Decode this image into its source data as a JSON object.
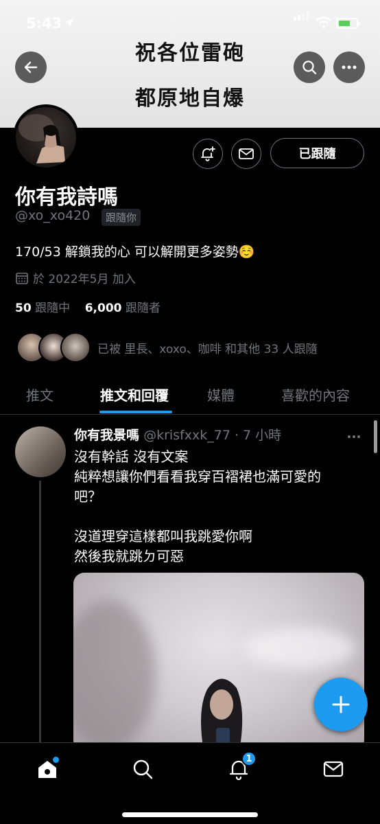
{
  "status_bar": {
    "time": "5:43"
  },
  "banner": {
    "line1": "祝各位雷砲",
    "line2": "都原地自爆"
  },
  "profile": {
    "display_name": "你有我詩嗎",
    "handle": "@xo_xo420",
    "follows_you_label": "跟隨你",
    "bio": "170/53 解鎖我的心 可以解開更多姿勢☺️",
    "joined": "於 2022年5月 加入",
    "following_count": "50",
    "following_label": "跟隨中",
    "followers_count": "6,000",
    "followers_label": "跟隨者",
    "followed_by": "已被 里長、xoxo、咖啡 和其他 33 人跟隨",
    "following_button": "已跟隨"
  },
  "tabs": [
    {
      "label": "推文",
      "active": false
    },
    {
      "label": "推文和回覆",
      "active": true
    },
    {
      "label": "媒體",
      "active": false
    },
    {
      "label": "喜歡的內容",
      "active": false
    }
  ],
  "tweet": {
    "name": "你有我景嗎",
    "handle_time": "@krisfxxk_77 · 7 小時",
    "lines": [
      "沒有幹話 沒有文案",
      "純粹想讓你們看看我穿百褶裙也滿可愛的",
      "吧？",
      "",
      "沒道理穿這樣都叫我跳愛你啊",
      "然後我就跳ㄉ可惡"
    ]
  },
  "bottom_nav": {
    "notifications_badge": "1"
  },
  "colors": {
    "accent": "#1d9bf0",
    "background": "#000000",
    "muted": "#71767b"
  },
  "icons": [
    "back-arrow-icon",
    "search-icon",
    "more-icon",
    "bell-plus-icon",
    "mail-icon",
    "calendar-icon",
    "plus-icon",
    "home-icon",
    "bell-icon"
  ]
}
